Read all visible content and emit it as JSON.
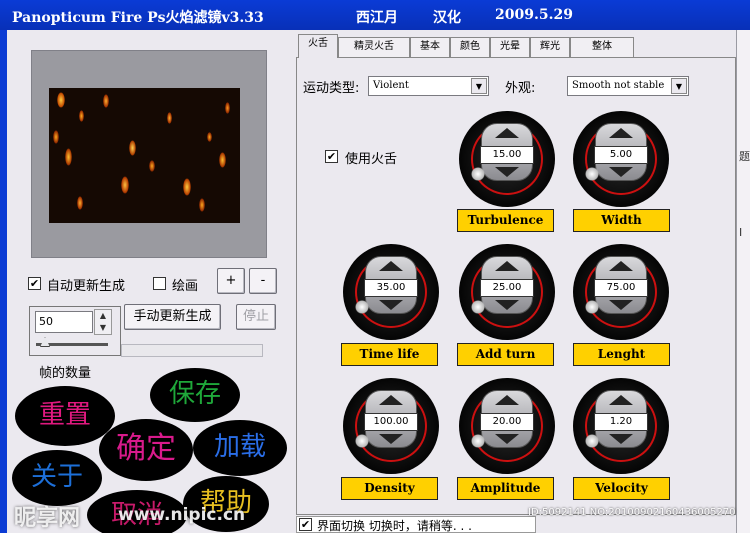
{
  "window": {
    "title_app": "Panopticum Fire Ps火焰滤镜v3.33",
    "title_author": "西江月",
    "title_role": "汉化",
    "title_date": "2009.5.29"
  },
  "left": {
    "auto_update_label": "自动更新生成",
    "auto_update_checked": "✔",
    "draw_label": "绘画",
    "plus_label": "+",
    "minus_label": "-",
    "frames_value": "50",
    "manual_update_label": "手动更新生成",
    "stop_label": "停止",
    "frames_label": "帧的数量"
  },
  "actions": {
    "reset": "重置",
    "save": "保存",
    "ok": "确定",
    "load": "加载",
    "about": "关于",
    "cancel": "取消",
    "help": "帮助"
  },
  "tabs": [
    "火舌",
    "精灵火舌",
    "基本",
    "颜色",
    "光晕",
    "辉光",
    "整体"
  ],
  "motion": {
    "type_label": "运动类型:",
    "type_value": "Violent",
    "look_label": "外观:",
    "look_value": "Smooth not stable",
    "use_tongue_label": "使用火舌",
    "use_tongue_checked": "✔"
  },
  "knobs": [
    {
      "name": "Turbulence",
      "value": "15.00"
    },
    {
      "name": "Width",
      "value": "5.00"
    },
    {
      "name": "Time life",
      "value": "35.00"
    },
    {
      "name": "Add turn",
      "value": "25.00"
    },
    {
      "name": "Lenght",
      "value": "75.00"
    },
    {
      "name": "Density",
      "value": "100.00"
    },
    {
      "name": "Amplitude",
      "value": "20.00"
    },
    {
      "name": "Velocity",
      "value": "1.20"
    }
  ],
  "bottom": {
    "checkbox_checked": "✔",
    "text": "界面切换    切换时，请稍等. . ."
  },
  "watermark": {
    "brand": "昵享网",
    "url": "www.nipic.cn",
    "id": "ID:5092141 NO:20100902160436005270"
  },
  "colors": {
    "titlebar": "#0a3bd6",
    "panel": "#ebe9ef",
    "knob_label": "#ffd000",
    "reset": "#e0197f",
    "save": "#1fa83a",
    "ok": "#d91a8c",
    "load": "#2a6ee8",
    "about": "#1d6fd8",
    "cancel": "#c81a6a",
    "help": "#e8c020"
  }
}
